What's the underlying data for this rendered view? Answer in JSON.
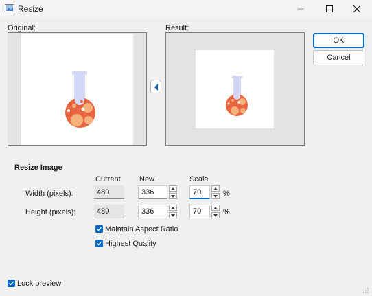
{
  "window": {
    "title": "Resize"
  },
  "preview": {
    "original_label": "Original:",
    "result_label": "Result:"
  },
  "buttons": {
    "ok": "OK",
    "cancel": "Cancel"
  },
  "resize": {
    "heading": "Resize Image",
    "columns": {
      "current": "Current",
      "new": "New",
      "scale": "Scale"
    },
    "width": {
      "label": "Width (pixels):",
      "current": "480",
      "new": "336",
      "scale": "70",
      "unit": "%"
    },
    "height": {
      "label": "Height (pixels):",
      "current": "480",
      "new": "336",
      "scale": "70",
      "unit": "%"
    }
  },
  "options": {
    "maintain_aspect": "Maintain Aspect Ratio",
    "maintain_checked": true,
    "highest_quality": "Highest Quality",
    "quality_checked": true
  },
  "lock_preview": {
    "label": "Lock preview",
    "checked": true
  },
  "colors": {
    "accent": "#0067c0",
    "flask_neck": "#d3d6f5",
    "liquid": "#e8663f",
    "bubble": "#f4b27a"
  }
}
